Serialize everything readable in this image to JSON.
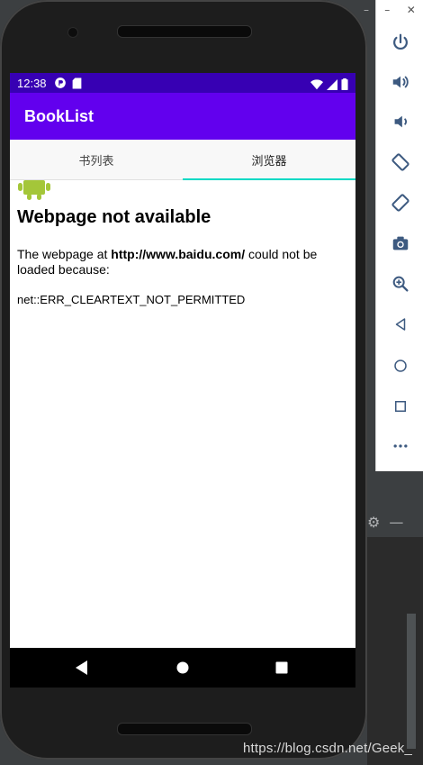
{
  "status_bar": {
    "time": "12:38"
  },
  "app_bar": {
    "title": "BookList"
  },
  "tabs": [
    {
      "label": "书列表",
      "active": false
    },
    {
      "label": "浏览器",
      "active": true
    }
  ],
  "webview_error": {
    "title": "Webpage not available",
    "body_prefix": "The webpage at ",
    "url": "http://www.baidu.com/",
    "body_suffix": " could not be loaded because:",
    "error_code": "net::ERR_CLEARTEXT_NOT_PERMITTED"
  },
  "side_panel": {
    "buttons": [
      "power-icon",
      "volume-up-icon",
      "volume-down-icon",
      "rotate-left-icon",
      "rotate-right-icon",
      "camera-icon",
      "zoom-icon",
      "back-icon",
      "home-icon",
      "overview-icon",
      "more-icon"
    ]
  },
  "watermark": "https://blog.csdn.net/Geek_",
  "colors": {
    "status_bar": "#3700b3",
    "app_bar": "#6200ee",
    "tab_indicator": "#03dac5",
    "android_green": "#a4c639"
  }
}
